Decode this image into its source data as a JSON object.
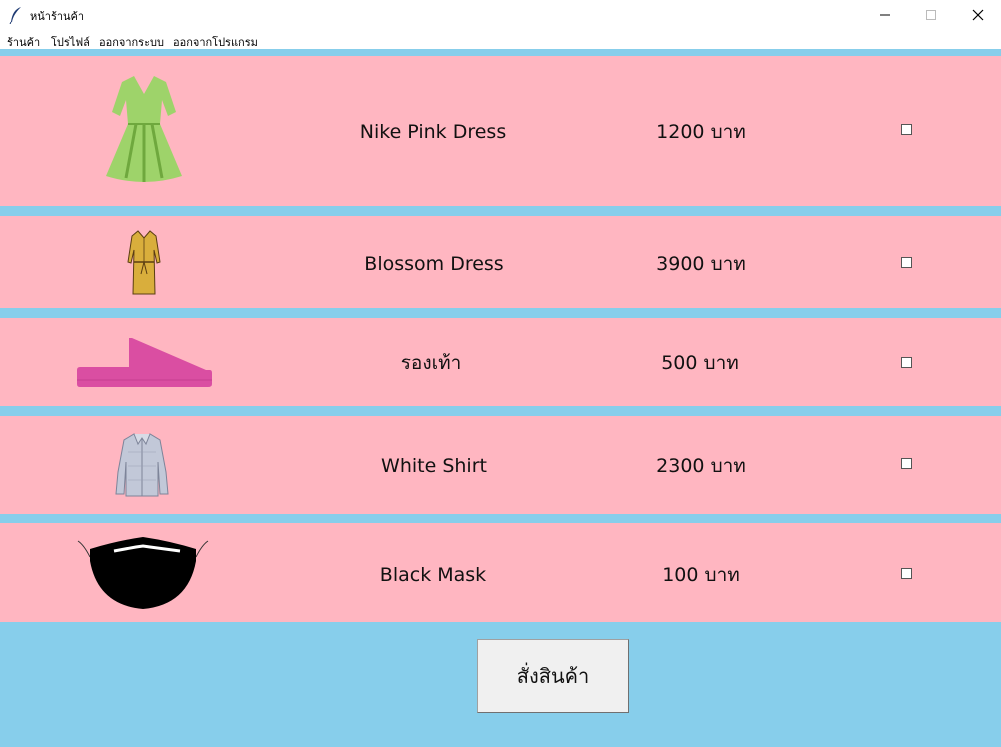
{
  "window": {
    "title": "หน้าร้านค้า"
  },
  "menu": {
    "items": [
      "ร้านค้า",
      "โปรไฟล์",
      "ออกจากระบบ",
      "ออกจากโปรแกรม"
    ]
  },
  "products": [
    {
      "name": "Nike Pink Dress",
      "price": "1200 บาท",
      "icon": "green-dress-icon",
      "checked": false
    },
    {
      "name": "Blossom Dress",
      "price": "3900 บาท",
      "icon": "yellow-dress-icon",
      "checked": false
    },
    {
      "name": "รองเท้า",
      "price": "500 บาท",
      "icon": "pink-shoe-icon",
      "checked": false
    },
    {
      "name": "White Shirt",
      "price": "2300 บาท",
      "icon": "shirt-icon",
      "checked": false
    },
    {
      "name": "Black Mask",
      "price": "100 บาท",
      "icon": "black-mask-icon",
      "checked": false
    }
  ],
  "order_button": {
    "label": "สั่งสินค้า"
  },
  "colors": {
    "background": "#87ceeb",
    "row": "#ffb6c1"
  }
}
